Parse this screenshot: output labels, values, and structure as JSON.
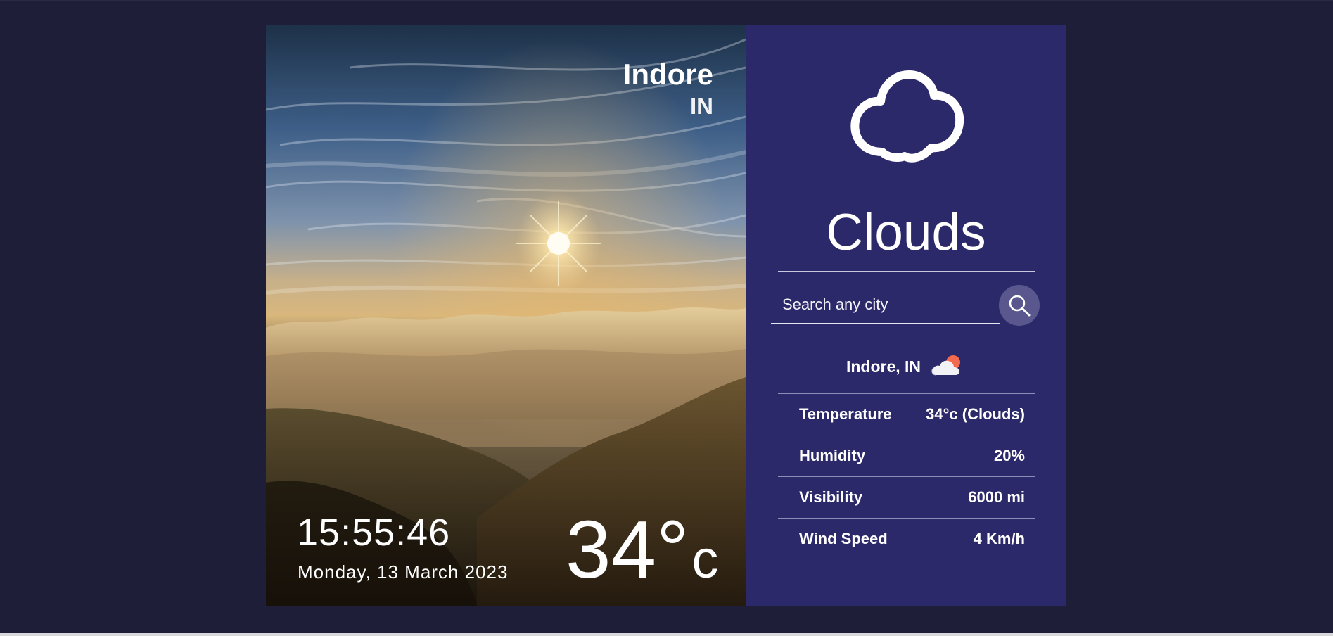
{
  "location": {
    "city": "Indore",
    "country": "IN",
    "combined": "Indore, IN"
  },
  "clock": {
    "time": "15:55:46",
    "date": "Monday, 13 March 2023"
  },
  "current": {
    "temperature": "34°",
    "unit": "c",
    "condition": "Clouds",
    "condition_icon": "cloud-icon",
    "location_icon": "cloud-sun-icon"
  },
  "search": {
    "placeholder": "Search any city",
    "button_icon": "search-icon"
  },
  "stats": [
    {
      "label": "Temperature",
      "value": "34°c (Clouds)"
    },
    {
      "label": "Humidity",
      "value": "20%"
    },
    {
      "label": "Visibility",
      "value": "6000 mi"
    },
    {
      "label": "Wind Speed",
      "value": "4 Km/h"
    }
  ],
  "colors": {
    "page_background": "#1e1e38",
    "info_panel": "#2c296a",
    "search_button": "#5a578f",
    "text": "#ffffff"
  }
}
